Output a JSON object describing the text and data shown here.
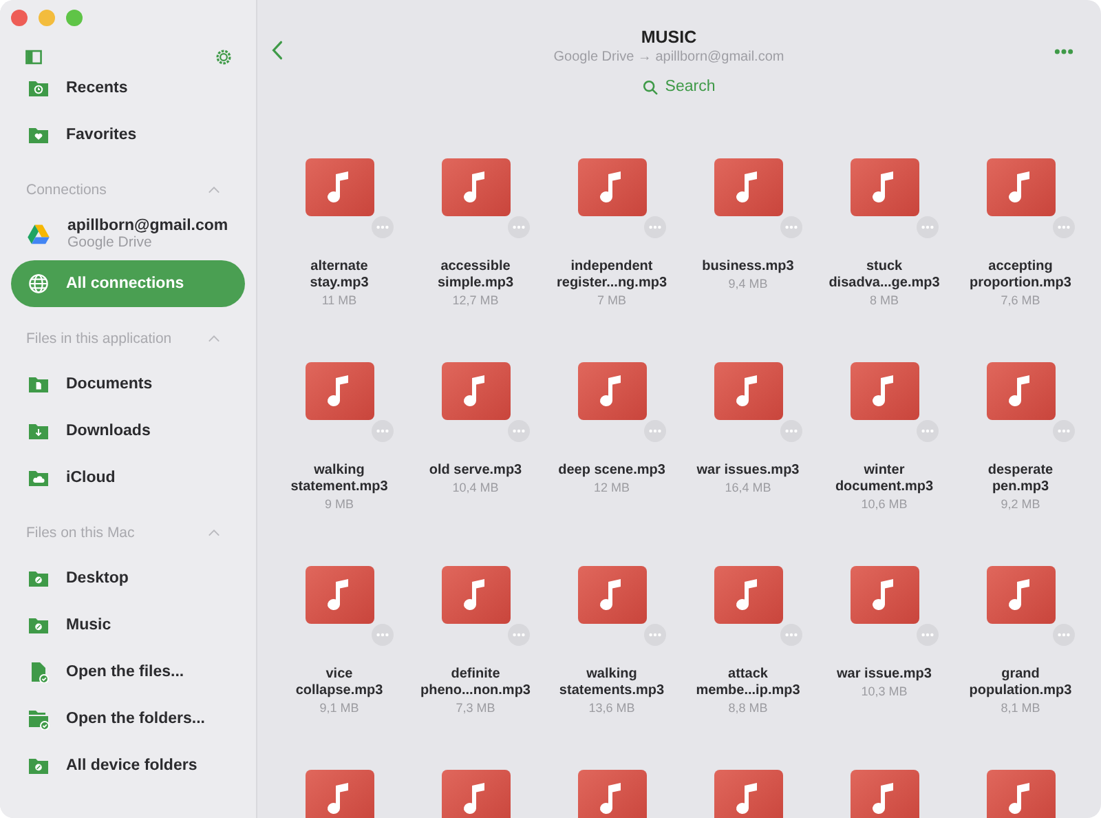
{
  "window": {
    "title": "MUSIC",
    "subtitle": "Google Drive → apillborn@gmail.com"
  },
  "search": {
    "label": "Search"
  },
  "sidebar": {
    "top_items": [
      {
        "label": "Recents",
        "kind": "clock",
        "selected": false
      },
      {
        "label": "Favorites",
        "kind": "heart",
        "selected": false
      }
    ],
    "sections": [
      {
        "title": "Connections",
        "expanded": true,
        "items": [
          {
            "label": "apillborn@gmail.com",
            "sublabel": "Google Drive",
            "kind": "drive",
            "selected": false
          },
          {
            "label": "All connections",
            "kind": "globe",
            "selected": true
          }
        ]
      },
      {
        "title": "Files in this application",
        "expanded": true,
        "items": [
          {
            "label": "Documents",
            "kind": "doc",
            "selected": false
          },
          {
            "label": "Downloads",
            "kind": "download",
            "selected": false
          },
          {
            "label": "iCloud",
            "kind": "cloud",
            "selected": false
          }
        ]
      },
      {
        "title": "Files on this Mac",
        "expanded": true,
        "items": [
          {
            "label": "Desktop",
            "kind": "disk",
            "selected": false
          },
          {
            "label": "Music",
            "kind": "disk",
            "selected": false
          },
          {
            "label": "Open the files...",
            "kind": "file",
            "selected": false
          },
          {
            "label": "Open the folders...",
            "kind": "folder",
            "selected": false
          },
          {
            "label": "All device folders",
            "kind": "disk",
            "selected": false
          }
        ]
      }
    ]
  },
  "files": [
    {
      "kind": "file",
      "name": "alternate\nstay.mp3",
      "size": "11 MB"
    },
    {
      "kind": "file",
      "name": "accessible\nsimple.mp3",
      "size": "12,7 MB"
    },
    {
      "kind": "file",
      "name": "independent\nregister...ng.mp3",
      "size": "7 MB"
    },
    {
      "kind": "file",
      "name": "business.mp3",
      "size": "9,4 MB"
    },
    {
      "kind": "file",
      "name": "stuck\ndisadva...ge.mp3",
      "size": "8 MB"
    },
    {
      "kind": "file",
      "name": "accepting\nproportion.mp3",
      "size": "7,6 MB"
    },
    {
      "kind": "file",
      "name": "walking\nstatement.mp3",
      "size": "9 MB"
    },
    {
      "kind": "file",
      "name": "old serve.mp3",
      "size": "10,4 MB"
    },
    {
      "kind": "file",
      "name": "deep scene.mp3",
      "size": "12 MB"
    },
    {
      "kind": "file",
      "name": "war issues.mp3",
      "size": "16,4 MB"
    },
    {
      "kind": "file",
      "name": "winter\ndocument.mp3",
      "size": "10,6 MB"
    },
    {
      "kind": "file",
      "name": "desperate\npen.mp3",
      "size": "9,2 MB"
    },
    {
      "kind": "file",
      "name": "vice\ncollapse.mp3",
      "size": "9,1 MB"
    },
    {
      "kind": "file",
      "name": "definite\npheno...non.mp3",
      "size": "7,3 MB"
    },
    {
      "kind": "file",
      "name": "walking\nstatements.mp3",
      "size": "13,6 MB"
    },
    {
      "kind": "file",
      "name": "attack\nmembe...ip.mp3",
      "size": "8,8 MB"
    },
    {
      "kind": "file",
      "name": "war issue.mp3",
      "size": "10,3 MB"
    },
    {
      "kind": "file",
      "name": "grand\npopulation.mp3",
      "size": "8,1 MB"
    },
    {
      "kind": "cut"
    },
    {
      "kind": "cut"
    },
    {
      "kind": "cut"
    },
    {
      "kind": "cut"
    },
    {
      "kind": "cut"
    },
    {
      "kind": "cut"
    }
  ]
}
